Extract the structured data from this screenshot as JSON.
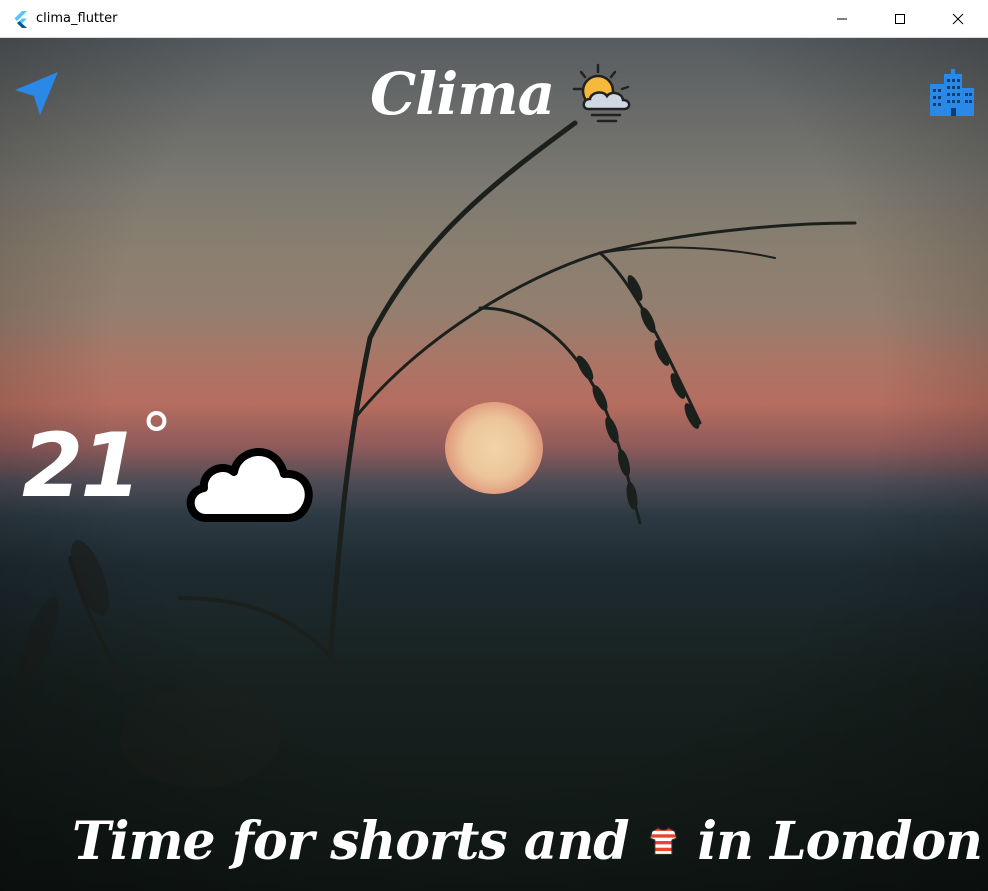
{
  "window": {
    "title": "clima_flutter",
    "app_icon": "flutter-logo-icon",
    "controls": [
      "minimize-icon",
      "maximize-icon",
      "close-icon"
    ]
  },
  "header": {
    "location_button_icon": "navigation-arrow-icon",
    "city_button_icon": "city-buildings-icon",
    "title": "Clima",
    "title_icon": "sun-behind-cloud-icon"
  },
  "weather": {
    "temperature": "21",
    "degree_symbol": "°",
    "condition_icon": "cloud-icon"
  },
  "message": {
    "prefix": "Time for shorts and",
    "icon": "striped-shirt-icon",
    "suffix": "in London"
  },
  "colors": {
    "accent_blue": "#2a88e6",
    "text": "#ffffff",
    "titlebar": "#ffffff"
  }
}
